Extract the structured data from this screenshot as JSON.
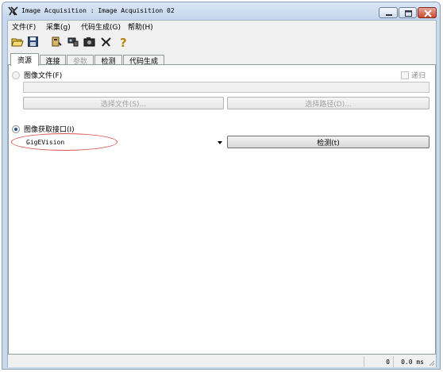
{
  "window": {
    "title": "Image Acquisition : Image Acquisition 02"
  },
  "menu": {
    "items": [
      {
        "label": "文件(F)"
      },
      {
        "label": "采集(g)"
      },
      {
        "label": "代码生成(G)"
      },
      {
        "label": "帮助(H)"
      }
    ]
  },
  "toolbar": {
    "icons": [
      "open-folder-icon",
      "save-icon",
      "load-icon",
      "connect-icon",
      "camera-icon",
      "settings-icon",
      "help-icon"
    ]
  },
  "tabs": [
    {
      "label": "资源",
      "active": true
    },
    {
      "label": "连接",
      "active": false
    },
    {
      "label": "参数",
      "disabled": true
    },
    {
      "label": "检测",
      "active": false
    },
    {
      "label": "代码生成",
      "active": false
    }
  ],
  "source": {
    "image_files_label": "图像文件(F)",
    "recursive_label": "递归",
    "select_file_button": "选择文件(S)...",
    "select_path_button": "选择路径(D)...",
    "interface_label": "图像获取接口(I)",
    "interface_value": "GigEVision",
    "detect_button": "检测(t)"
  },
  "status": {
    "count": "0",
    "time": "0.0 ms"
  }
}
